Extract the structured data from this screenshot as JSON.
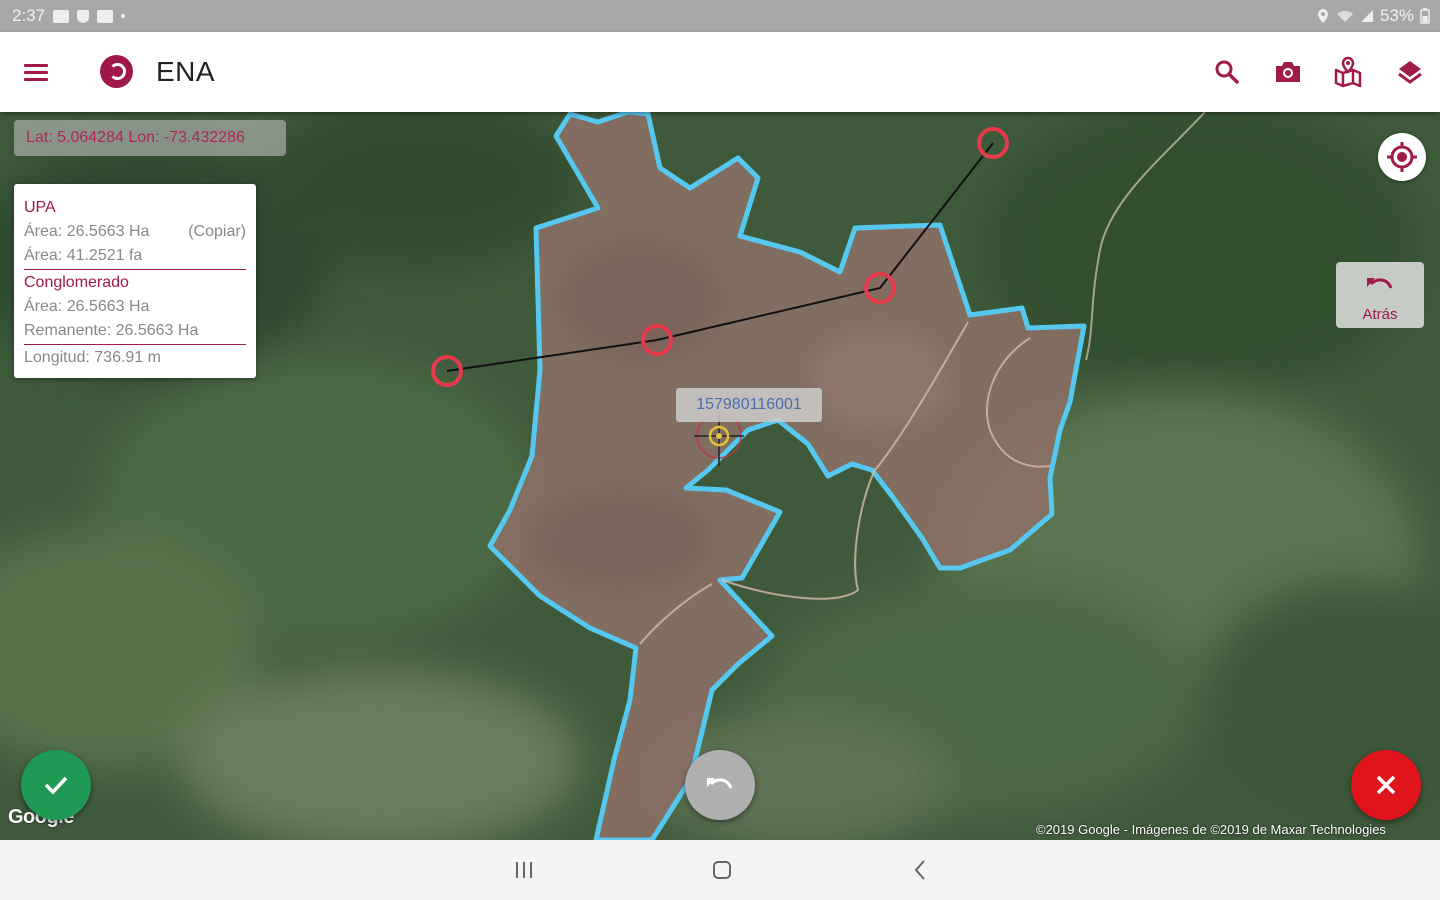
{
  "status_bar": {
    "time": "2:37",
    "battery": "53%",
    "icons": [
      "gallery-icon",
      "shield-icon",
      "youtube-icon",
      "location-icon",
      "wifi-icon",
      "signal-icon",
      "battery-icon"
    ]
  },
  "app_bar": {
    "title": "ENA",
    "actions": [
      "search-icon",
      "camera-icon",
      "map-marker-icon",
      "layers-icon"
    ]
  },
  "coordinates": {
    "text": "Lat: 5.064284  Lon: -73.432286"
  },
  "info_card": {
    "upa_label": "UPA",
    "area_ha": "Área: 26.5663 Ha",
    "copy_label": "(Copiar)",
    "area_fa": "Área: 41.2521 fa",
    "conglomerado_label": "Conglomerado",
    "cong_area": "Área: 26.5663 Ha",
    "remanente": "Remanente: 26.5663 Ha",
    "longitud": "Longitud: 736.91 m"
  },
  "parcel_label": "157980116001",
  "back_button": {
    "label": "Atrás"
  },
  "map": {
    "google_logo": "Google",
    "attribution": "©2019 Google - Imágenes de ©2019 de Maxar Technologies"
  },
  "colors": {
    "brand": "#a01a4a",
    "parcel_outline": "#56c8f0",
    "measure_point": "#e53a4a",
    "ok_fab": "#1f9a55",
    "cancel_fab": "#e0141a"
  }
}
